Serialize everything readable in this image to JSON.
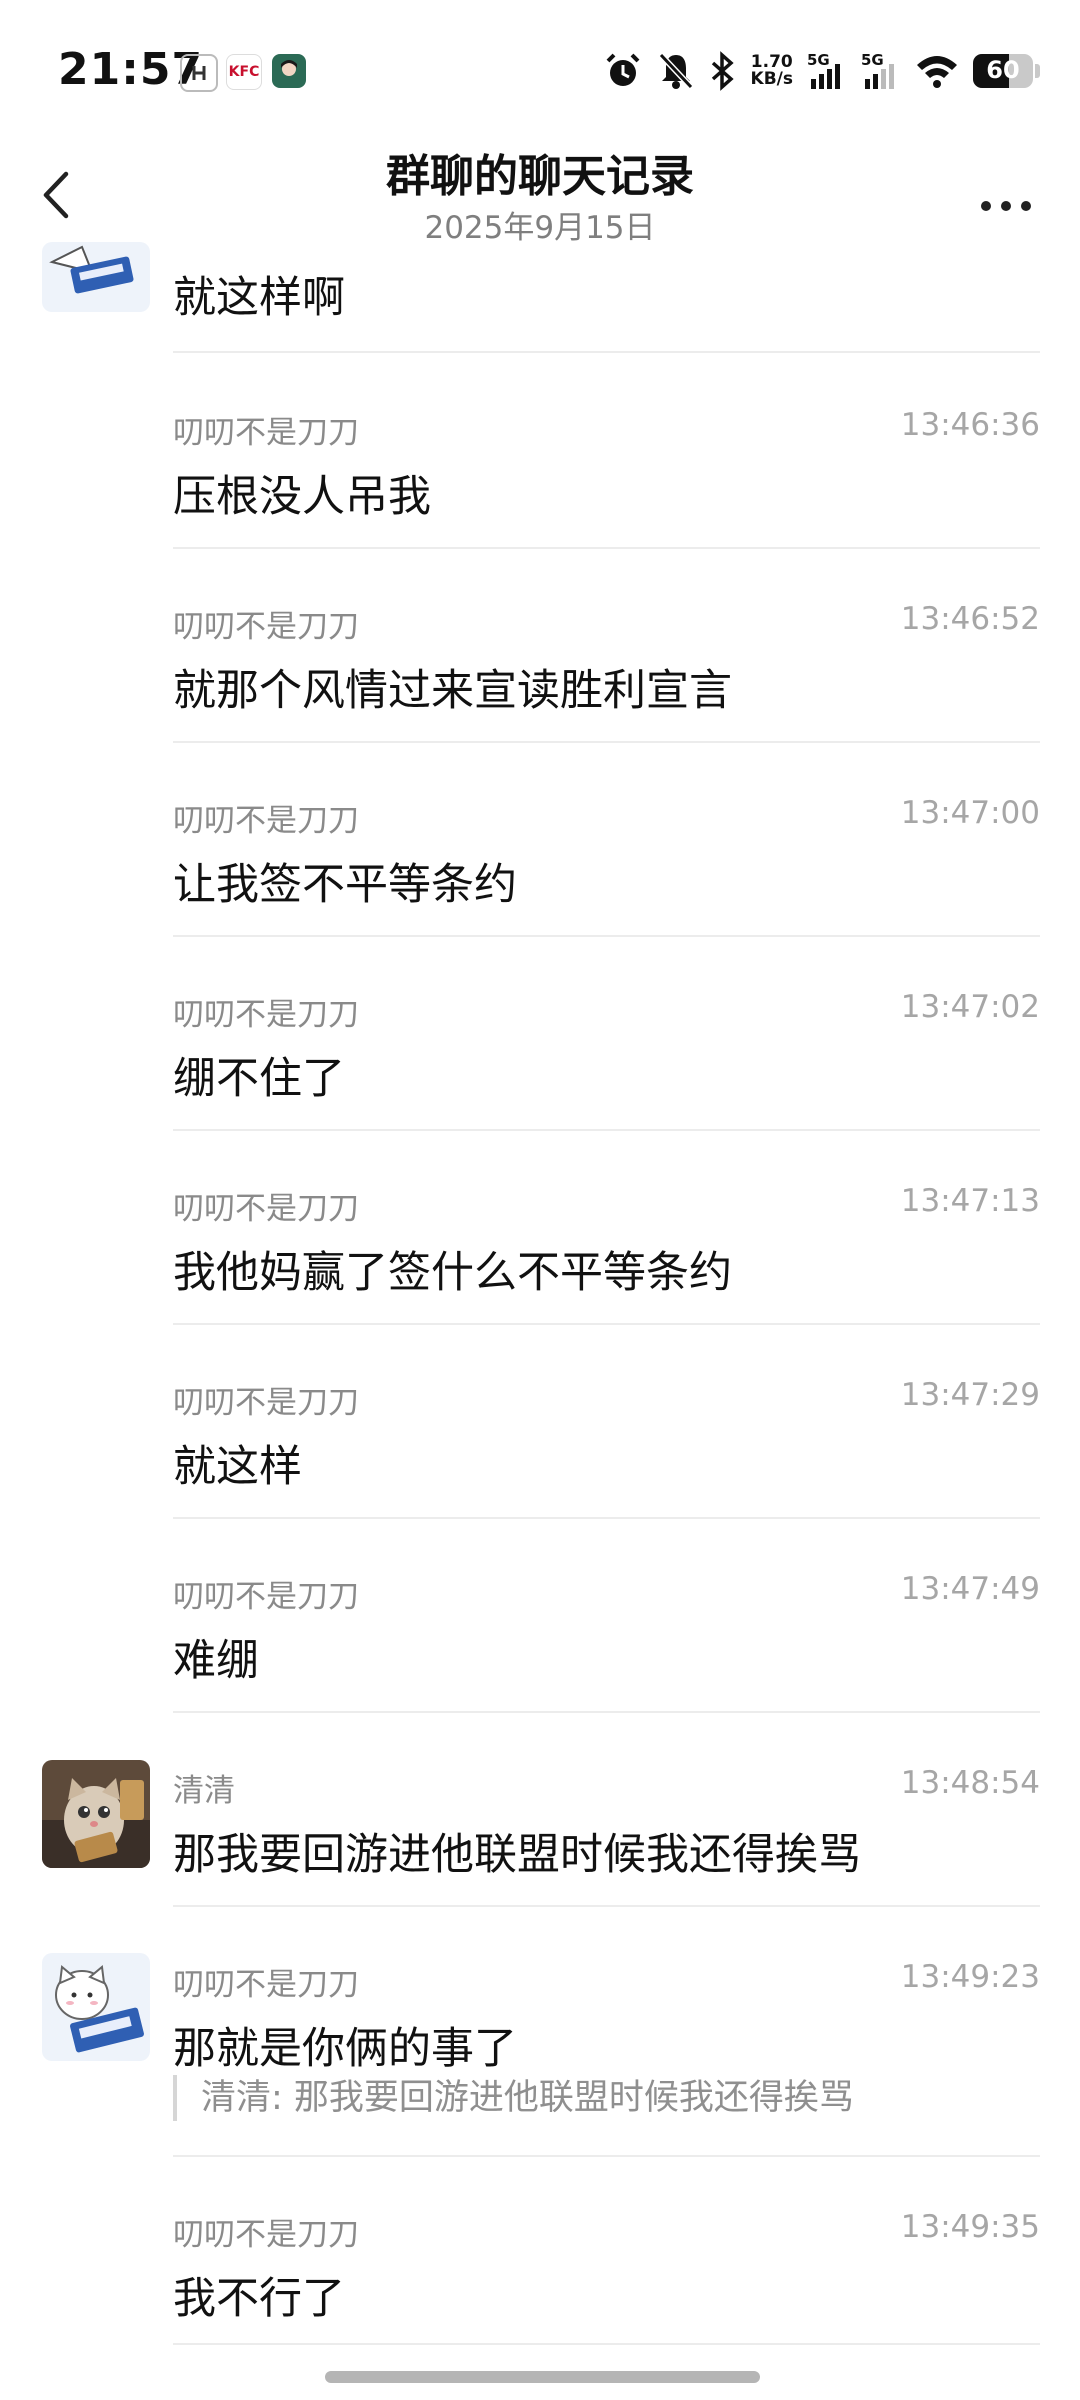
{
  "status_bar": {
    "time": "21:57",
    "network_speed_value": "1.70",
    "network_speed_unit": "KB/s",
    "signal_1_label": "5G",
    "signal_2_label": "5G",
    "battery_level": "60",
    "app_icon_kfc": "KFC"
  },
  "header": {
    "title": "群聊的聊天记录",
    "subtitle": "2025年9月15日"
  },
  "messages": [
    {
      "sender": "",
      "time": "",
      "text": "就这样啊",
      "quote": ""
    },
    {
      "sender": "叨叨不是刀刀",
      "time": "13:46:36",
      "text": "压根没人吊我",
      "quote": ""
    },
    {
      "sender": "叨叨不是刀刀",
      "time": "13:46:52",
      "text": "就那个风情过来宣读胜利宣言",
      "quote": ""
    },
    {
      "sender": "叨叨不是刀刀",
      "time": "13:47:00",
      "text": "让我签不平等条约",
      "quote": ""
    },
    {
      "sender": "叨叨不是刀刀",
      "time": "13:47:02",
      "text": "绷不住了",
      "quote": ""
    },
    {
      "sender": "叨叨不是刀刀",
      "time": "13:47:13",
      "text": "我他妈赢了签什么不平等条约",
      "quote": ""
    },
    {
      "sender": "叨叨不是刀刀",
      "time": "13:47:29",
      "text": "就这样",
      "quote": ""
    },
    {
      "sender": "叨叨不是刀刀",
      "time": "13:47:49",
      "text": "难绷",
      "quote": ""
    },
    {
      "sender": "清清",
      "time": "13:48:54",
      "text": "那我要回游进他联盟时候我还得挨骂",
      "quote": ""
    },
    {
      "sender": "叨叨不是刀刀",
      "time": "13:49:23",
      "text": "那就是你俩的事了",
      "quote": "清清:  那我要回游进他联盟时候我还得挨骂"
    },
    {
      "sender": "叨叨不是刀刀",
      "time": "13:49:35",
      "text": "我不行了",
      "quote": ""
    }
  ],
  "colors": {
    "background": "#ffffff",
    "text_primary": "#111111",
    "text_secondary": "#8a8a8a",
    "divider": "#ececec",
    "avatar_sign_blue": "#2f5fb3"
  },
  "icons": {
    "back": "chevron-left-icon",
    "more": "more-dots-icon",
    "alarm": "alarm-icon",
    "mute": "bell-off-icon",
    "bluetooth": "bluetooth-icon",
    "wifi": "wifi-icon"
  }
}
